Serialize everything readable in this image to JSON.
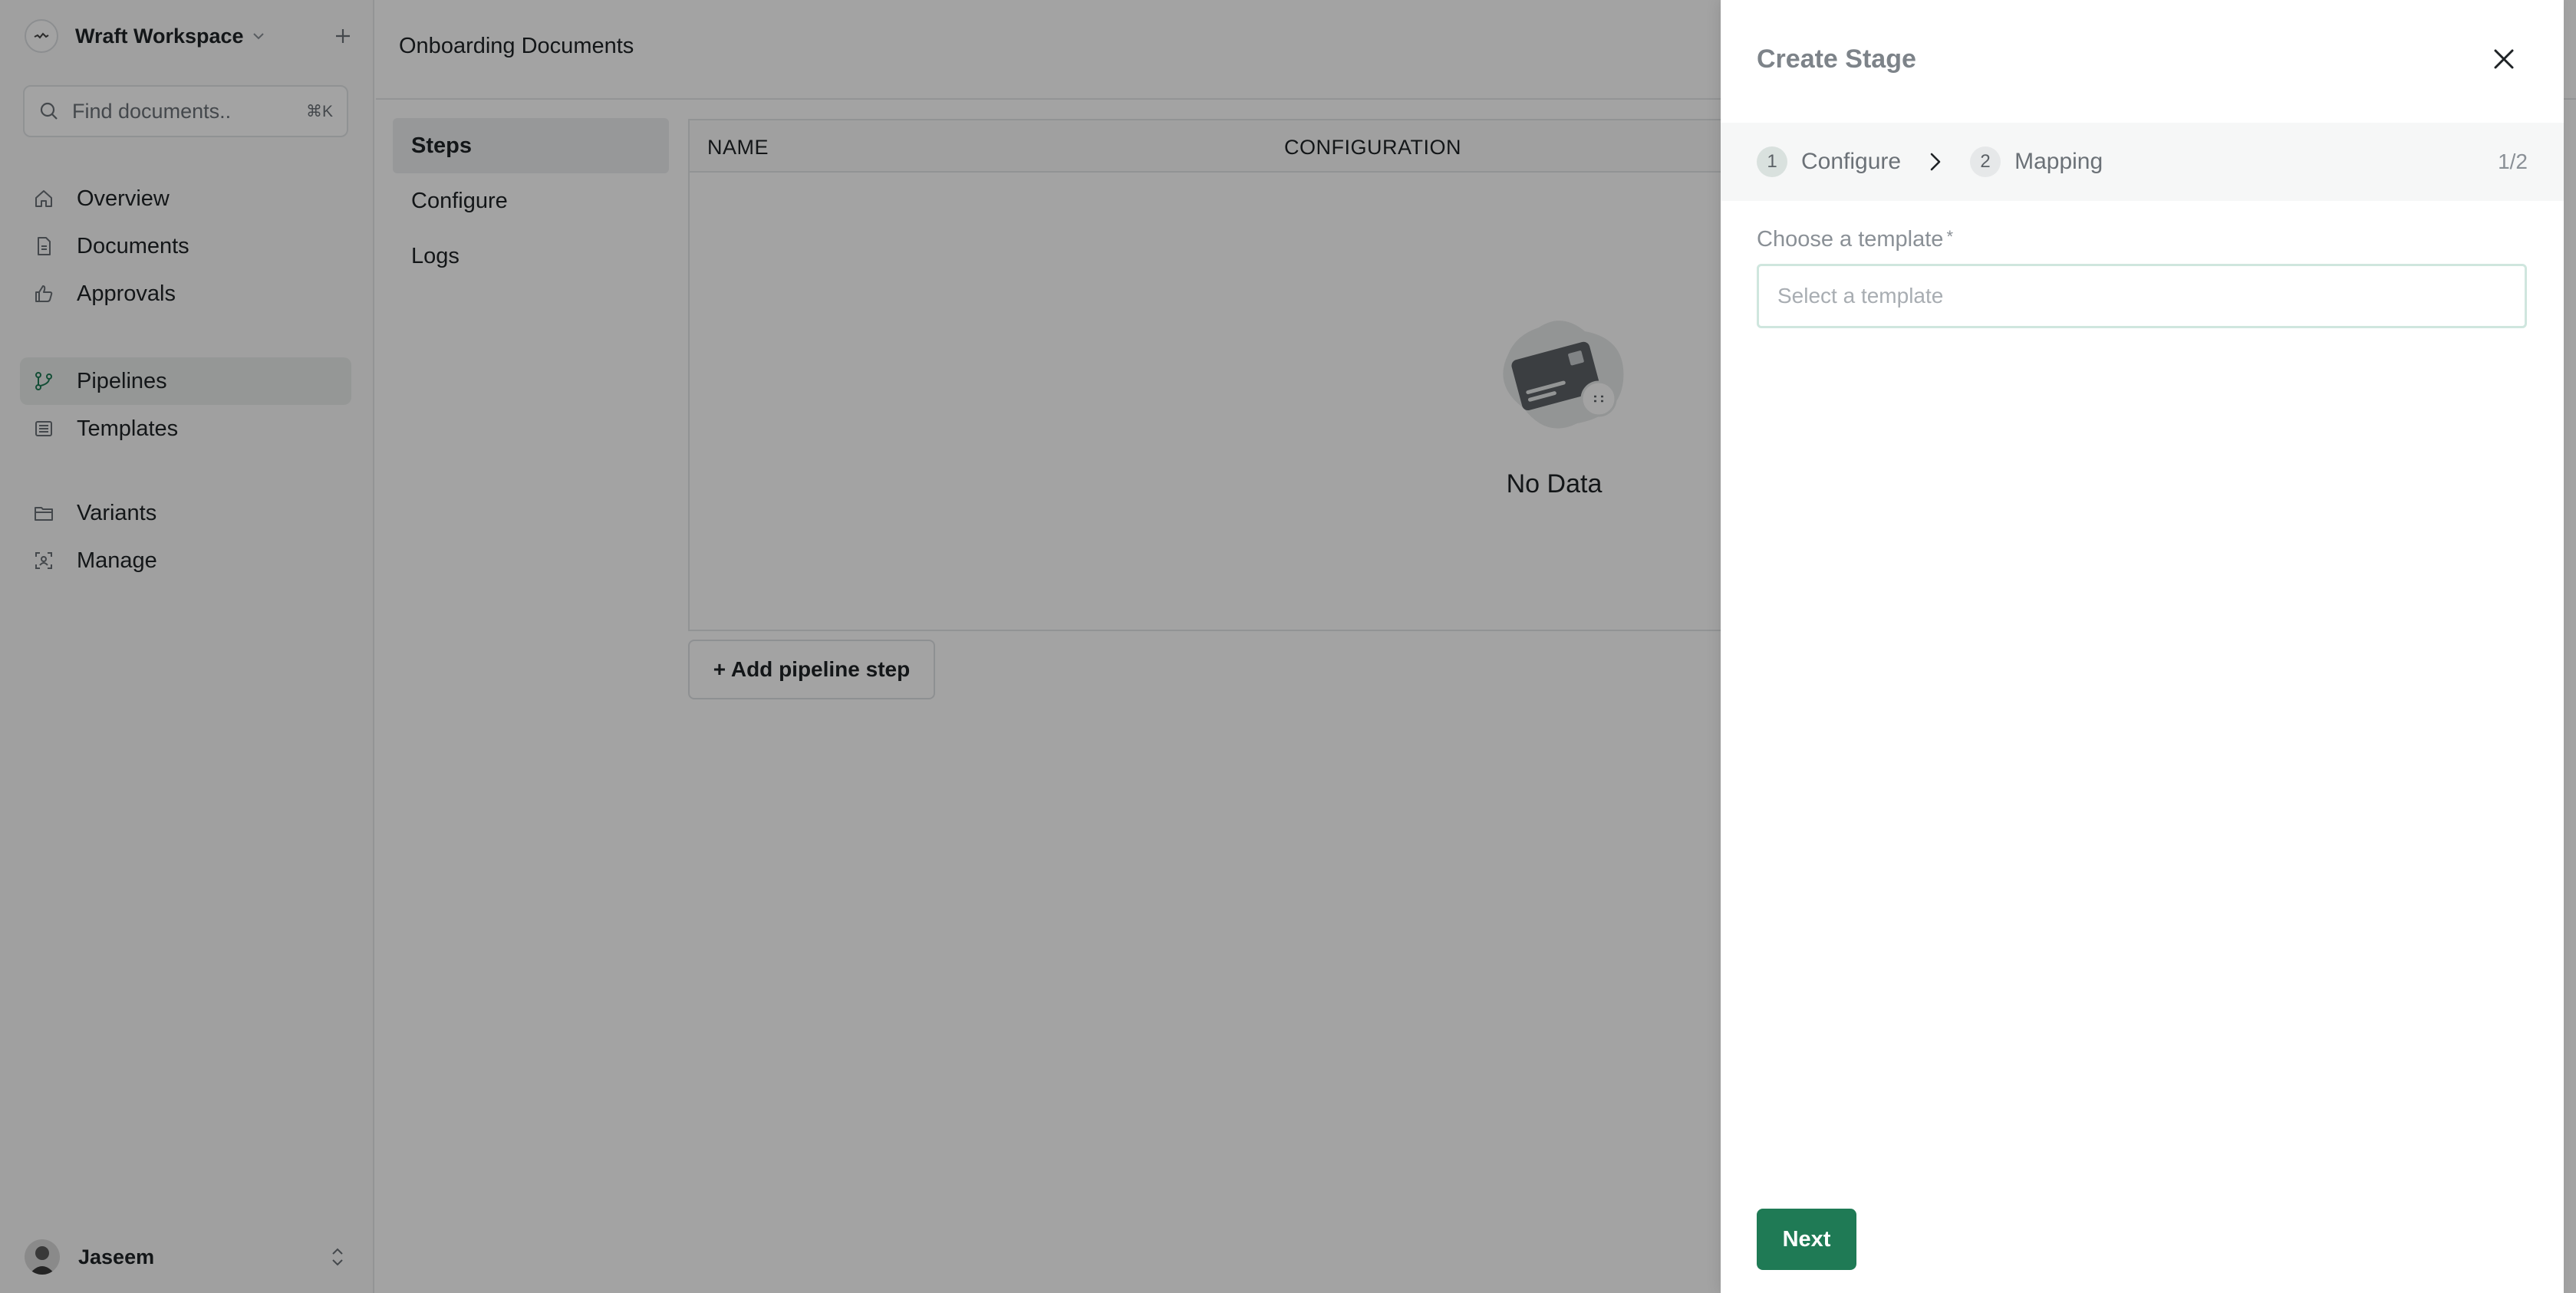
{
  "workspace": {
    "name": "Wraft Workspace"
  },
  "search": {
    "placeholder": "Find documents..",
    "shortcut": "⌘K"
  },
  "sidebar": {
    "groups": [
      [
        {
          "label": "Overview",
          "icon": "home-icon"
        },
        {
          "label": "Documents",
          "icon": "document-icon"
        },
        {
          "label": "Approvals",
          "icon": "thumbs-up-icon"
        }
      ],
      [
        {
          "label": "Pipelines",
          "icon": "pipeline-icon",
          "active": true
        },
        {
          "label": "Templates",
          "icon": "template-icon"
        }
      ],
      [
        {
          "label": "Variants",
          "icon": "variants-icon"
        },
        {
          "label": "Manage",
          "icon": "manage-icon"
        }
      ]
    ]
  },
  "user": {
    "name": "Jaseem"
  },
  "page": {
    "title": "Onboarding Documents"
  },
  "subnav": {
    "items": [
      "Steps",
      "Configure",
      "Logs"
    ],
    "active": "Steps"
  },
  "table": {
    "columns": [
      "NAME",
      "CONFIGURATION"
    ],
    "empty_text": "No Data"
  },
  "add_step_label": "+ Add pipeline step",
  "drawer": {
    "title": "Create Stage",
    "steps": [
      {
        "number": "1",
        "label": "Configure"
      },
      {
        "number": "2",
        "label": "Mapping"
      }
    ],
    "step_count": "1/2",
    "field_label": "Choose a template",
    "required_mark": "*",
    "template_placeholder": "Select a template",
    "template_value": "",
    "next_label": "Next"
  },
  "colors": {
    "accent": "#1f7a55",
    "overlay": "rgba(0,0,0,0.36)"
  }
}
